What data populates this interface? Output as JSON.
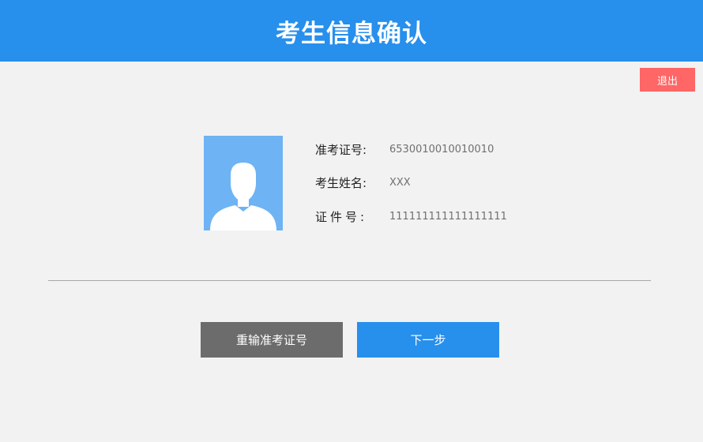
{
  "header": {
    "title": "考生信息确认"
  },
  "exit_button": {
    "label": "退出"
  },
  "profile": {
    "avatar_icon": "user-silhouette-icon",
    "fields": [
      {
        "label": "准考证号:",
        "value": "6530010010010010"
      },
      {
        "label": "考生姓名:",
        "value": "XXX"
      },
      {
        "label": "证件号:",
        "value": "111111111111111111"
      }
    ]
  },
  "actions": {
    "reenter_label": "重输准考证号",
    "next_label": "下一步"
  },
  "colors": {
    "header_bg": "#278fec",
    "exit_bg": "#ff6666",
    "avatar_bg": "#6eb3f4",
    "reenter_bg": "#6c6c6c",
    "next_bg": "#278fec",
    "page_bg": "#f2f2f2"
  }
}
